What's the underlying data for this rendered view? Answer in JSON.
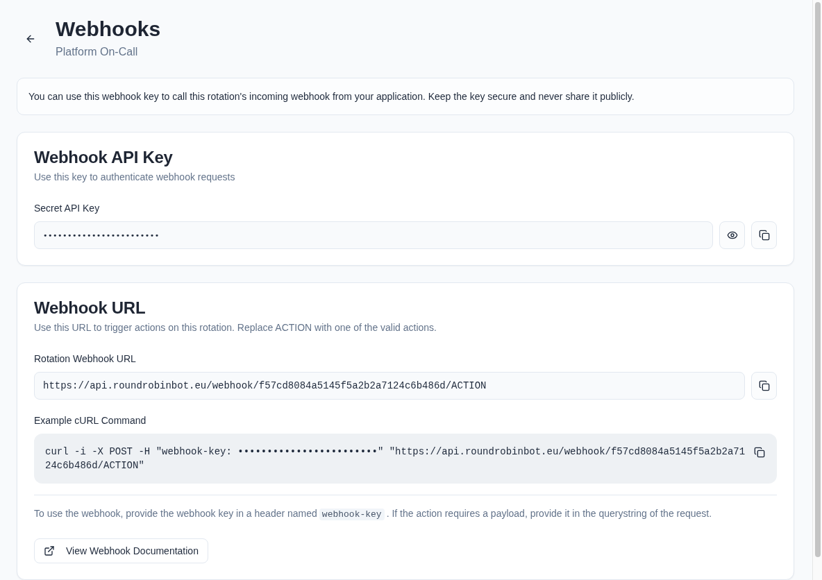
{
  "header": {
    "title": "Webhooks",
    "subtitle": "Platform On-Call"
  },
  "notice": "You can use this webhook key to call this rotation's incoming webhook from your application. Keep the key secure and never share it publicly.",
  "api_key_card": {
    "title": "Webhook API Key",
    "description": "Use this key to authenticate webhook requests",
    "field": {
      "label": "Secret API Key",
      "value": "••••••••••••••••••••••••"
    }
  },
  "url_card": {
    "title": "Webhook URL",
    "description": "Use this URL to trigger actions on this rotation. Replace ACTION with one of the valid actions.",
    "url_field": {
      "label": "Rotation Webhook URL",
      "value": "https://api.roundrobinbot.eu/webhook/f57cd8084a5145f5a2b2a7124c6b486d/ACTION"
    },
    "curl": {
      "label": "Example cURL Command",
      "command": "curl -i -X POST -H \"webhook-key: ••••••••••••••••••••••••\" \"https://api.roundrobinbot.eu/webhook/f57cd8084a5145f5a2b2a7124c6b486d/ACTION\""
    },
    "note": {
      "before": "To use the webhook, provide the webhook key in a header named",
      "code": "webhook-key",
      "after": ". If the action requires a payload, provide it in the querystring of the request."
    },
    "docs_button": "View Webhook Documentation"
  }
}
